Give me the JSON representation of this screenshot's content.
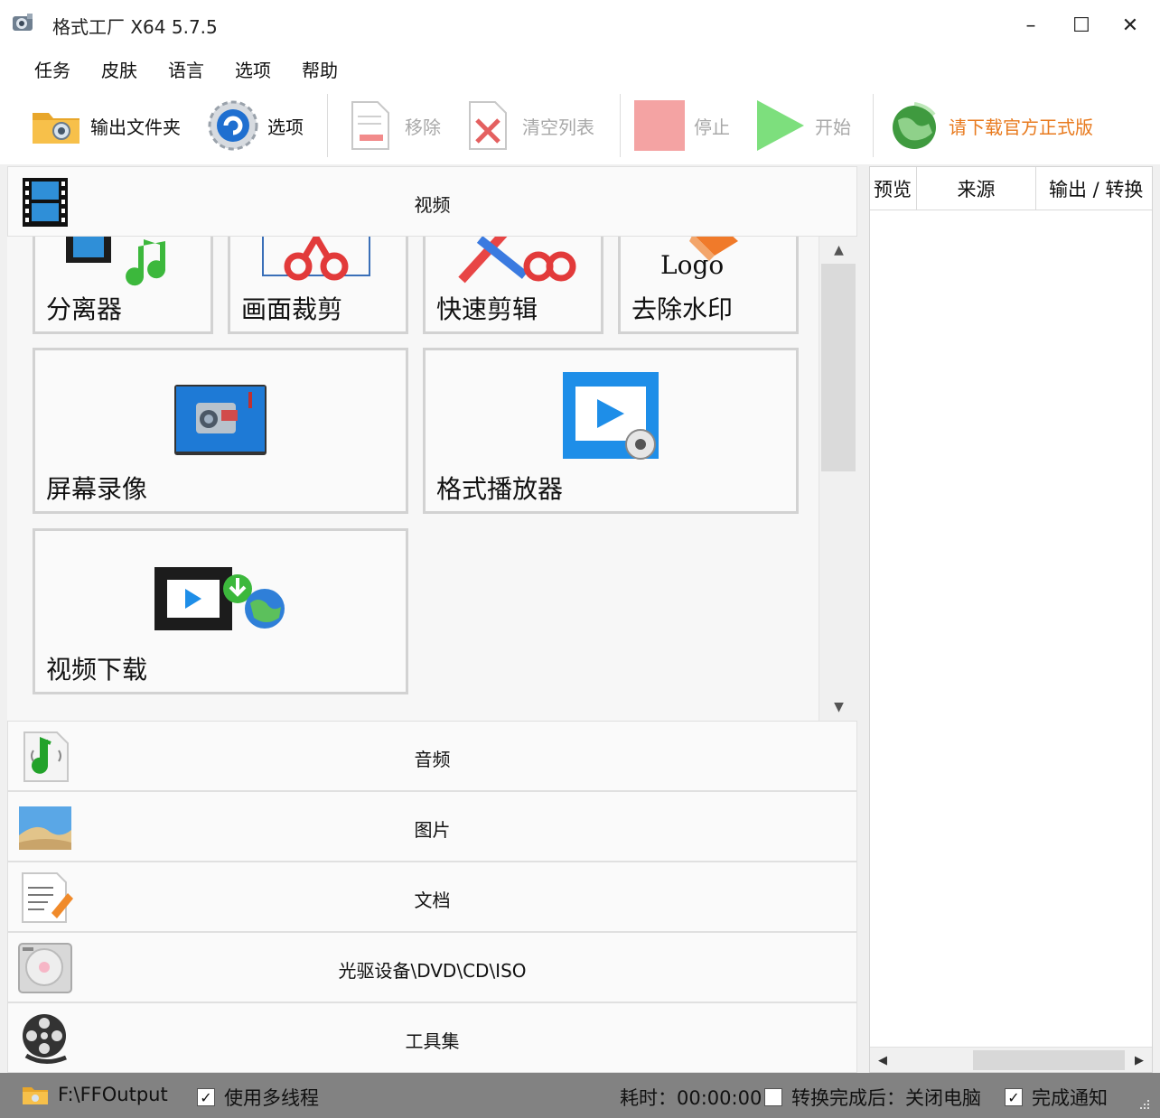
{
  "window": {
    "title": "格式工厂 X64 5.7.5",
    "minimize": "–",
    "maximize": "☐",
    "close": "✕"
  },
  "menu": {
    "items": [
      "任务",
      "皮肤",
      "语言",
      "选项",
      "帮助"
    ]
  },
  "toolbar": {
    "output_folder": "输出文件夹",
    "options": "选项",
    "remove": "移除",
    "clear_list": "清空列表",
    "stop": "停止",
    "start": "开始",
    "download_official": "请下载官方正式版"
  },
  "categories": {
    "video": "视频",
    "audio": "音频",
    "image": "图片",
    "document": "文档",
    "optical": "光驱设备\\DVD\\CD\\ISO",
    "tools": "工具集"
  },
  "video_tiles": {
    "splitter": "分离器",
    "crop": "画面裁剪",
    "quick_edit": "快速剪辑",
    "remove_watermark": "去除水印",
    "logo_text": "Logo",
    "screen_record": "屏幕录像",
    "player": "格式播放器",
    "video_download": "视频下载"
  },
  "task_list": {
    "columns": [
      "预览",
      "来源",
      "输出 / 转换"
    ]
  },
  "statusbar": {
    "output_path": "F:\\FFOutput",
    "multithread_label": "使用多线程",
    "multithread_checked": true,
    "elapsed": "耗时：00:00:00",
    "shutdown_label": "转换完成后：关闭电脑",
    "shutdown_checked": false,
    "notify_label": "完成通知",
    "notify_checked": true
  },
  "colors": {
    "promo_text": "#e87a1e",
    "disabled_text": "#a8a8a8",
    "status_bg": "#828282",
    "stop_red": "#f4a3a3",
    "start_green": "#7ddf7d"
  }
}
